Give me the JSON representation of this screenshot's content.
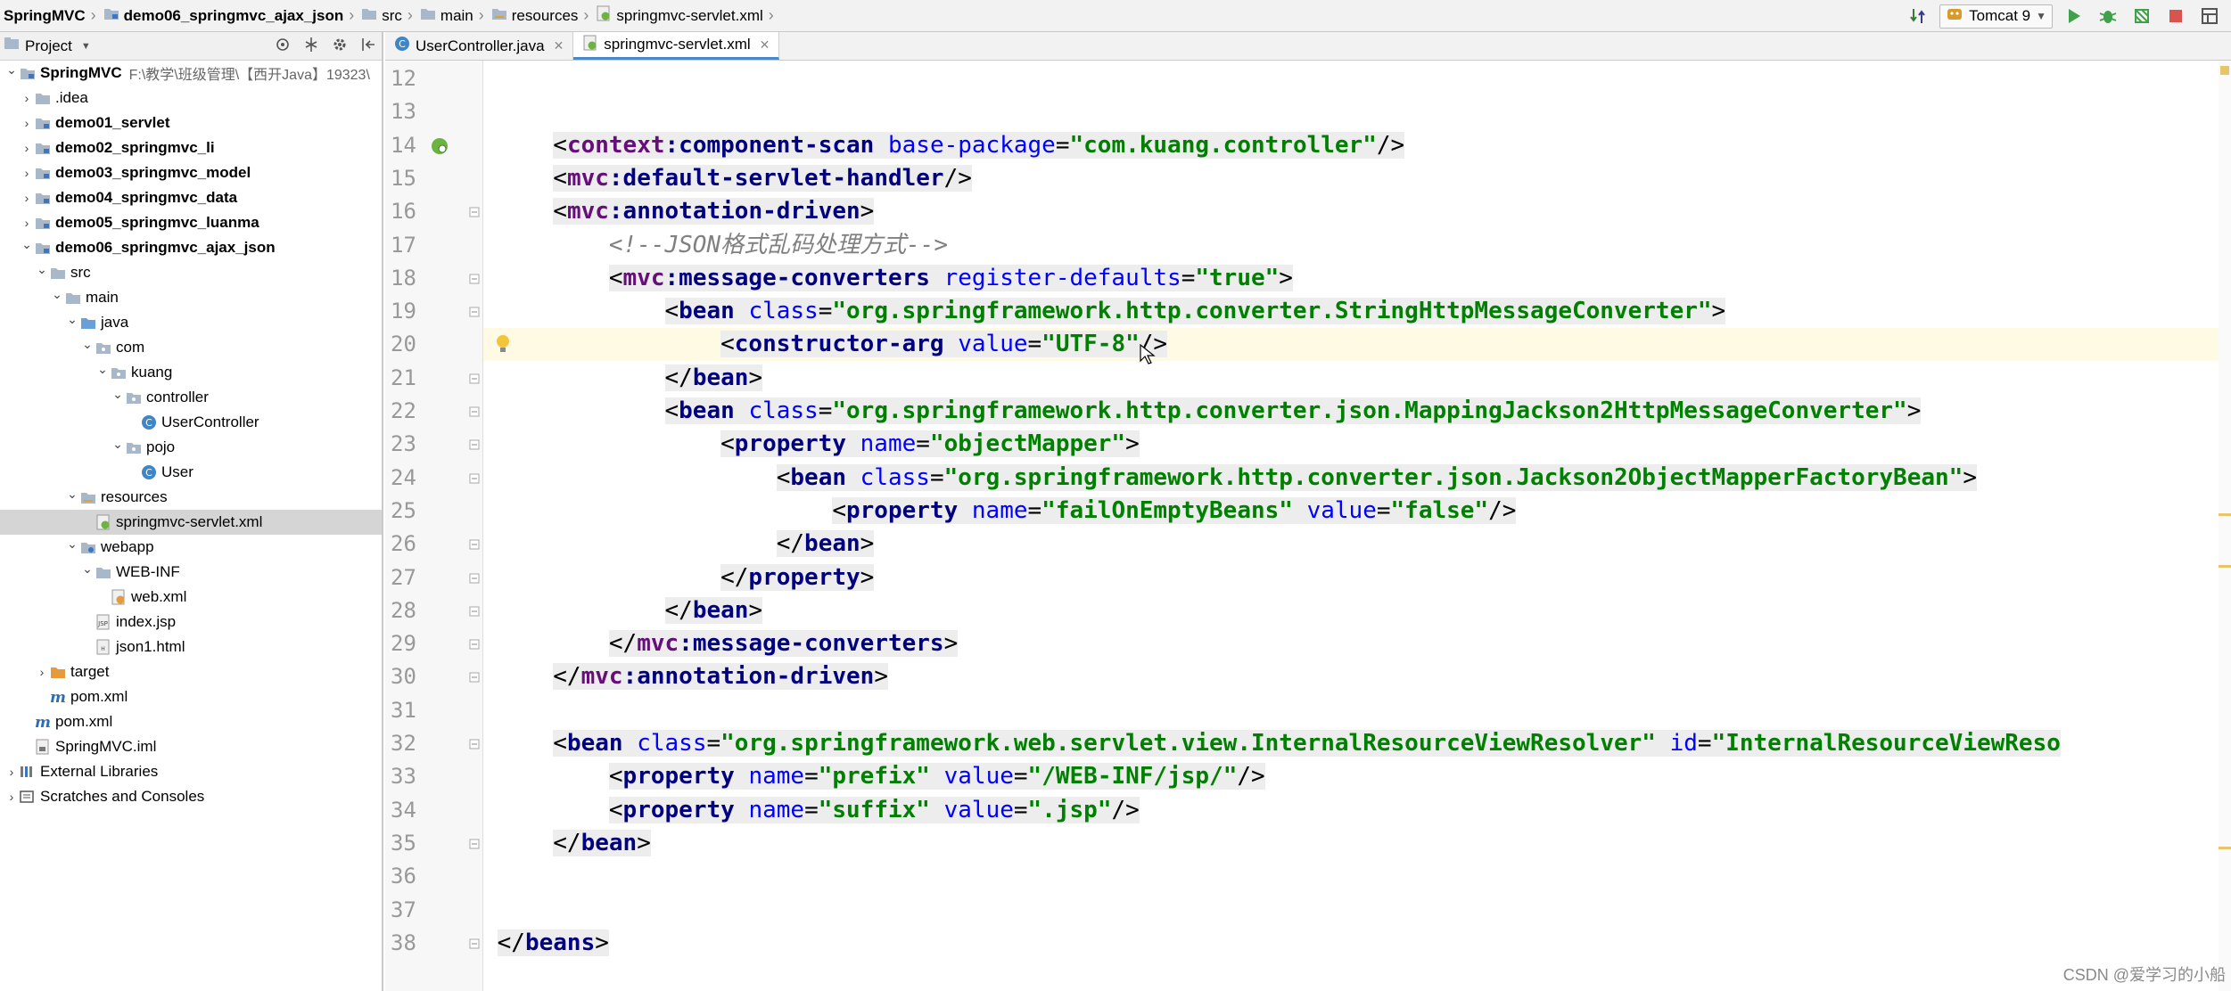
{
  "breadcrumbs": [
    "SpringMVC",
    "demo06_springmvc_ajax_json",
    "src",
    "main",
    "resources",
    "springmvc-servlet.xml"
  ],
  "run_config": {
    "label": "Tomcat 9"
  },
  "project_panel": {
    "title": "Project",
    "tree": [
      {
        "label": "SpringMVC",
        "path": "F:\\教学\\班级管理\\【西开Java】19323\\",
        "icon": "module-folder-icon",
        "bold": true,
        "depth": 0,
        "arrow": "open"
      },
      {
        "label": ".idea",
        "icon": "folder-icon",
        "bold": false,
        "depth": 1,
        "arrow": "closed"
      },
      {
        "label": "demo01_servlet",
        "icon": "module-folder-icon",
        "bold": true,
        "depth": 1,
        "arrow": "closed"
      },
      {
        "label": "demo02_springmvc_li",
        "icon": "module-folder-icon",
        "bold": true,
        "depth": 1,
        "arrow": "closed"
      },
      {
        "label": "demo03_springmvc_model",
        "icon": "module-folder-icon",
        "bold": true,
        "depth": 1,
        "arrow": "closed"
      },
      {
        "label": "demo04_springmvc_data",
        "icon": "module-folder-icon",
        "bold": true,
        "depth": 1,
        "arrow": "closed"
      },
      {
        "label": "demo05_springmvc_luanma",
        "icon": "module-folder-icon",
        "bold": true,
        "depth": 1,
        "arrow": "closed"
      },
      {
        "label": "demo06_springmvc_ajax_json",
        "icon": "module-folder-icon",
        "bold": true,
        "depth": 1,
        "arrow": "open"
      },
      {
        "label": "src",
        "icon": "folder-icon",
        "bold": false,
        "depth": 2,
        "arrow": "open"
      },
      {
        "label": "main",
        "icon": "folder-icon",
        "bold": false,
        "depth": 3,
        "arrow": "open"
      },
      {
        "label": "java",
        "icon": "source-folder-icon",
        "bold": false,
        "depth": 4,
        "arrow": "open"
      },
      {
        "label": "com",
        "icon": "package-icon",
        "bold": false,
        "depth": 5,
        "arrow": "open"
      },
      {
        "label": "kuang",
        "icon": "package-icon",
        "bold": false,
        "depth": 6,
        "arrow": "open"
      },
      {
        "label": "controller",
        "icon": "package-icon",
        "bold": false,
        "depth": 7,
        "arrow": "open"
      },
      {
        "label": "UserController",
        "icon": "java-class-icon",
        "bold": false,
        "depth": 8,
        "arrow": "none"
      },
      {
        "label": "pojo",
        "icon": "package-icon",
        "bold": false,
        "depth": 7,
        "arrow": "open"
      },
      {
        "label": "User",
        "icon": "java-class-icon",
        "bold": false,
        "depth": 8,
        "arrow": "none"
      },
      {
        "label": "resources",
        "icon": "resources-folder-icon",
        "bold": false,
        "depth": 4,
        "arrow": "open"
      },
      {
        "label": "springmvc-servlet.xml",
        "icon": "spring-xml-icon",
        "bold": false,
        "depth": 5,
        "arrow": "none",
        "selected": true
      },
      {
        "label": "webapp",
        "icon": "web-folder-icon",
        "bold": false,
        "depth": 4,
        "arrow": "open"
      },
      {
        "label": "WEB-INF",
        "icon": "folder-icon",
        "bold": false,
        "depth": 5,
        "arrow": "open"
      },
      {
        "label": "web.xml",
        "icon": "web-xml-icon",
        "bold": false,
        "depth": 6,
        "arrow": "none"
      },
      {
        "label": "index.jsp",
        "icon": "jsp-icon",
        "bold": false,
        "depth": 5,
        "arrow": "none"
      },
      {
        "label": "json1.html",
        "icon": "html-icon",
        "bold": false,
        "depth": 5,
        "arrow": "none"
      },
      {
        "label": "target",
        "icon": "excluded-folder-icon",
        "bold": false,
        "depth": 2,
        "arrow": "closed"
      },
      {
        "label": "pom.xml",
        "icon": "maven-icon",
        "bold": false,
        "depth": 2,
        "arrow": "none"
      },
      {
        "label": "pom.xml",
        "icon": "maven-icon",
        "bold": false,
        "depth": 1,
        "arrow": "none"
      },
      {
        "label": "SpringMVC.iml",
        "icon": "iml-icon",
        "bold": false,
        "depth": 1,
        "arrow": "none"
      },
      {
        "label": "External Libraries",
        "icon": "libraries-icon",
        "bold": false,
        "depth": 0,
        "arrow": "closed"
      },
      {
        "label": "Scratches and Consoles",
        "icon": "scratches-icon",
        "bold": false,
        "depth": 0,
        "arrow": "closed"
      }
    ]
  },
  "editor": {
    "tabs": [
      {
        "label": "UserController.java",
        "icon": "java-class-icon",
        "active": false
      },
      {
        "label": "springmvc-servlet.xml",
        "icon": "spring-xml-icon",
        "active": true
      }
    ],
    "current_line": "20",
    "lines": [
      {
        "n": "12",
        "text": ""
      },
      {
        "n": "13",
        "text": ""
      },
      {
        "n": "14",
        "text": "    <context:component-scan base-package=\"com.kuang.controller\"/>"
      },
      {
        "n": "15",
        "text": "    <mvc:default-servlet-handler/>"
      },
      {
        "n": "16",
        "text": "    <mvc:annotation-driven>"
      },
      {
        "n": "17",
        "text": "        <!--JSON格式乱码处理方式-->"
      },
      {
        "n": "18",
        "text": "        <mvc:message-converters register-defaults=\"true\">"
      },
      {
        "n": "19",
        "text": "            <bean class=\"org.springframework.http.converter.StringHttpMessageConverter\">"
      },
      {
        "n": "20",
        "text": "                <constructor-arg value=\"UTF-8\"/>"
      },
      {
        "n": "21",
        "text": "            </bean>"
      },
      {
        "n": "22",
        "text": "            <bean class=\"org.springframework.http.converter.json.MappingJackson2HttpMessageConverter\">"
      },
      {
        "n": "23",
        "text": "                <property name=\"objectMapper\">"
      },
      {
        "n": "24",
        "text": "                    <bean class=\"org.springframework.http.converter.json.Jackson2ObjectMapperFactoryBean\">"
      },
      {
        "n": "25",
        "text": "                        <property name=\"failOnEmptyBeans\" value=\"false\"/>"
      },
      {
        "n": "26",
        "text": "                    </bean>"
      },
      {
        "n": "27",
        "text": "                </property>"
      },
      {
        "n": "28",
        "text": "            </bean>"
      },
      {
        "n": "29",
        "text": "        </mvc:message-converters>"
      },
      {
        "n": "30",
        "text": "    </mvc:annotation-driven>"
      },
      {
        "n": "31",
        "text": ""
      },
      {
        "n": "32",
        "text": "    <bean class=\"org.springframework.web.servlet.view.InternalResourceViewResolver\" id=\"InternalResourceViewReso"
      },
      {
        "n": "33",
        "text": "        <property name=\"prefix\" value=\"/WEB-INF/jsp/\"/>"
      },
      {
        "n": "34",
        "text": "        <property name=\"suffix\" value=\".jsp\"/>"
      },
      {
        "n": "35",
        "text": "    </bean>"
      },
      {
        "n": "36",
        "text": ""
      },
      {
        "n": "37",
        "text": ""
      },
      {
        "n": "38",
        "text": "</beans>"
      }
    ]
  },
  "watermark": "CSDN @爱学习的小船",
  "colors": {
    "tag": "#000080",
    "namespace": "#660e7a",
    "attribute": "#0000ff",
    "value": "#008000",
    "comment": "#808080",
    "current_line": "#fffae3",
    "selection": "#d5d5d5"
  }
}
